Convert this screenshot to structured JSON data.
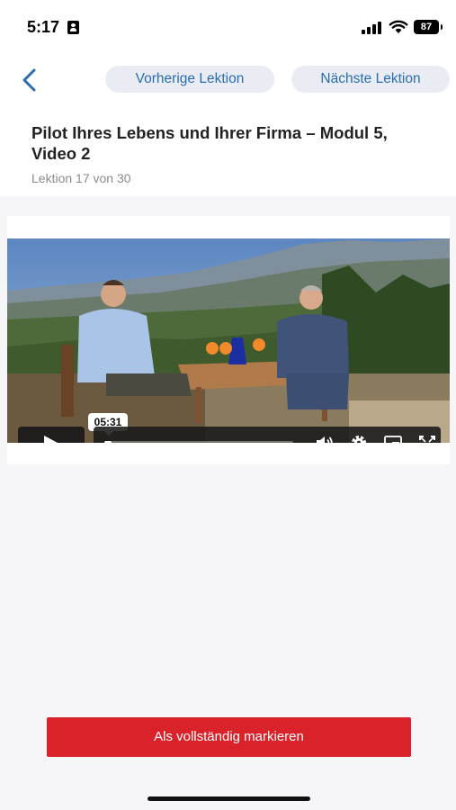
{
  "status": {
    "time": "5:17",
    "battery": "87"
  },
  "nav": {
    "back_icon": "chevron-left-icon",
    "prev_label": "Vorherige Lektion",
    "next_label": "Nächste Lektion"
  },
  "lesson": {
    "title": "Pilot Ihres Lebens und Ihrer Firma – Modul 5, Video 2",
    "subtitle": "Lektion 17 von 30"
  },
  "video": {
    "time_tooltip": "05:31",
    "progress": 0.04,
    "controls": [
      "play-icon",
      "volume-icon",
      "settings-gear-icon",
      "picture-in-picture-icon",
      "fullscreen-icon"
    ]
  },
  "actions": {
    "complete_label": "Als vollständig markieren"
  },
  "colors": {
    "accent_blue": "#2b6cb0",
    "pill_bg": "#e9edf3",
    "primary_red": "#d9222a"
  }
}
